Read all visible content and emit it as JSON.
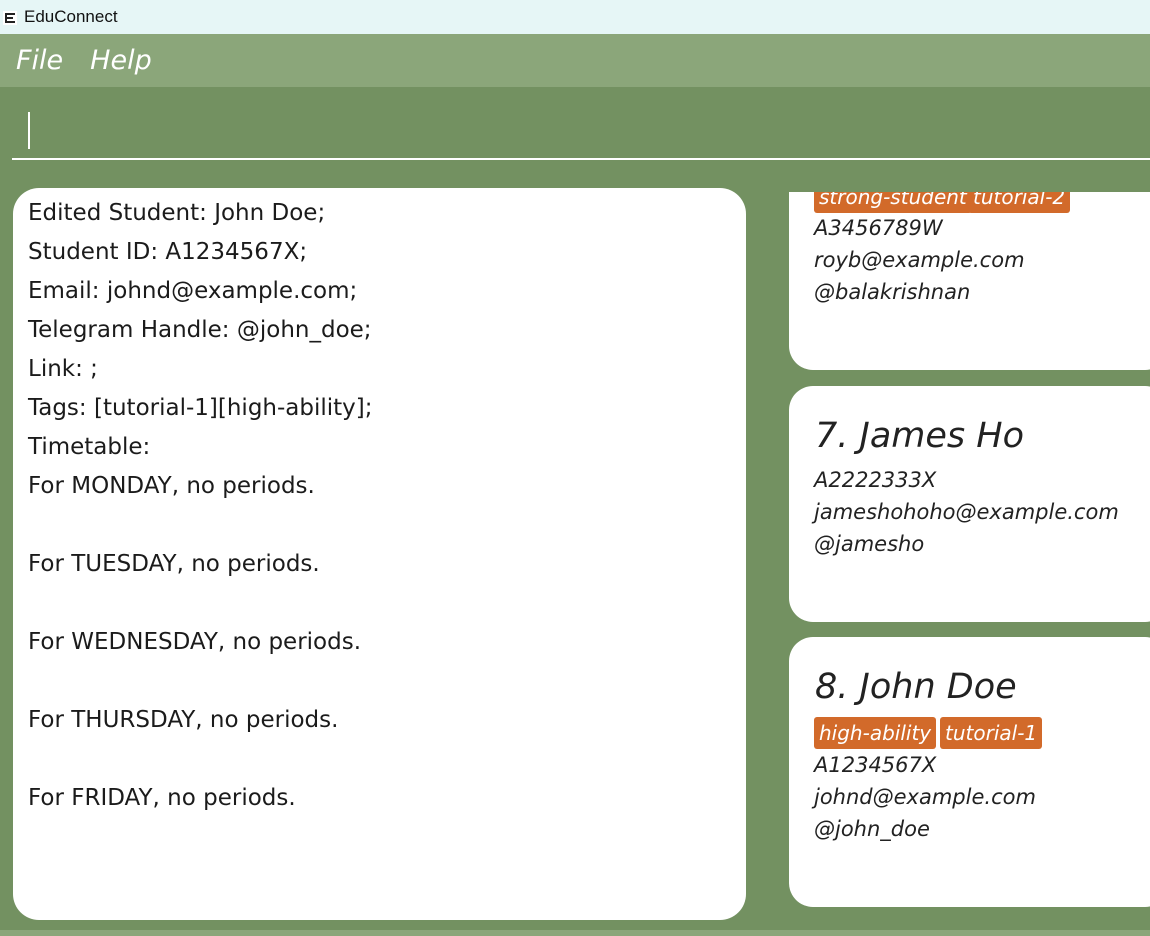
{
  "window": {
    "title": "EduConnect"
  },
  "menu": {
    "file": "File",
    "help": "Help"
  },
  "command": {
    "value": ""
  },
  "result": {
    "lines": [
      "Edited Student: John Doe;",
      "Student ID: A1234567X;",
      "Email: johnd@example.com;",
      "Telegram Handle: @john_doe;",
      "Link: ;",
      "Tags: [tutorial-1][high-ability];",
      "Timetable:",
      "For MONDAY, no periods.",
      "For TUESDAY, no periods.",
      "For WEDNESDAY, no periods.",
      "For THURSDAY, no periods.",
      "For FRIDAY, no periods."
    ]
  },
  "students": [
    {
      "tags": [
        "strong-student",
        "tutorial-2"
      ],
      "id": "A3456789W",
      "email": "royb@example.com",
      "handle": "@balakrishnan"
    },
    {
      "name": "7.  James Ho",
      "id": "A2222333X",
      "email": "jameshohoho@example.com",
      "handle": "@jamesho"
    },
    {
      "name": "8.  John Doe",
      "tags": [
        "high-ability",
        "tutorial-1"
      ],
      "id": "A1234567X",
      "email": "johnd@example.com",
      "handle": "@john_doe"
    }
  ],
  "colors": {
    "background": "#739161",
    "menubar": "#8ba67a",
    "tag": "#d26a2a",
    "titlebar": "#e6f6f6"
  }
}
